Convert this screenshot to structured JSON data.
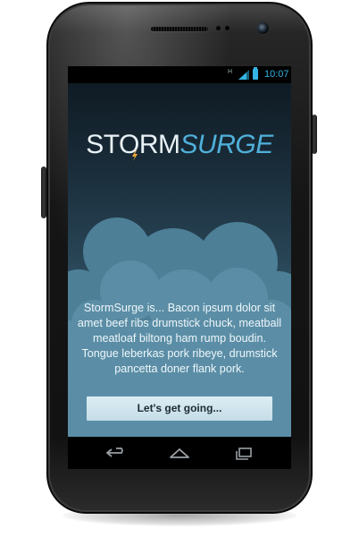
{
  "status_bar": {
    "time": "10:07",
    "network_type": "H",
    "icons": [
      "hplus-icon",
      "signal-icon",
      "battery-icon"
    ]
  },
  "app": {
    "logo": {
      "part1": "STORM",
      "part2": "SURGE"
    },
    "description": "StormSurge is... Bacon ipsum dolor sit amet beef ribs drumstick chuck, meatball meatloaf biltong ham rump boudin. Tongue leberkas pork ribeye, drumstick pancetta doner flank pork.",
    "cta_label": "Let's get going..."
  },
  "nav_bar": {
    "icons": [
      "back-icon",
      "home-icon",
      "recent-apps-icon"
    ]
  },
  "colors": {
    "accent": "#33b5e5",
    "logo_surge": "#4fb0da",
    "button_bg": "#d3e7f0",
    "cloud": "#5b8ea6"
  }
}
